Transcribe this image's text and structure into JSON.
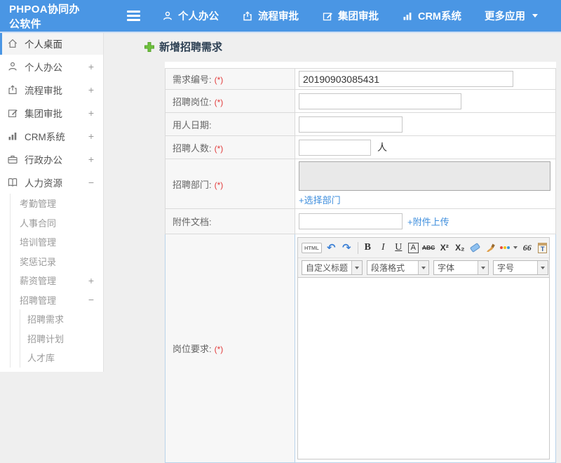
{
  "colors": {
    "topbar": "#4a96e4",
    "link": "#3e8edd",
    "required": "#e23b3b",
    "plus": "#6fc13e"
  },
  "topbar": {
    "brand": "PHPOA协同办公软件",
    "nav": [
      {
        "label": "个人办公"
      },
      {
        "label": "流程审批"
      },
      {
        "label": "集团审批"
      },
      {
        "label": "CRM系统"
      },
      {
        "label": "更多应用"
      }
    ]
  },
  "sidebar": {
    "items": [
      {
        "label": "个人桌面"
      },
      {
        "label": "个人办公",
        "expand": "+"
      },
      {
        "label": "流程审批",
        "expand": "+"
      },
      {
        "label": "集团审批",
        "expand": "+"
      },
      {
        "label": "CRM系统",
        "expand": "+"
      },
      {
        "label": "行政办公",
        "expand": "+"
      },
      {
        "label": "人力资源",
        "expand": "−"
      },
      {
        "label": "考勤管理"
      },
      {
        "label": "人事合同"
      },
      {
        "label": "培训管理"
      },
      {
        "label": "奖惩记录"
      },
      {
        "label": "薪资管理",
        "expand": "+"
      },
      {
        "label": "招聘管理",
        "expand": "−"
      },
      {
        "label": "招聘需求"
      },
      {
        "label": "招聘计划"
      },
      {
        "label": "人才库"
      }
    ]
  },
  "main": {
    "page_title": "新增招聘需求",
    "form": {
      "rows": [
        {
          "label": "需求编号:",
          "required": "(*)",
          "value": "20190903085431"
        },
        {
          "label": "招聘岗位:",
          "required": "(*)",
          "value": ""
        },
        {
          "label": "用人日期:",
          "value": ""
        },
        {
          "label": "招聘人数:",
          "required": "(*)",
          "value": "",
          "suffix": "人"
        },
        {
          "label": "招聘部门:",
          "required": "(*)",
          "link": "+选择部门"
        },
        {
          "label": "附件文档:",
          "value": "",
          "link": "+附件上传"
        },
        {
          "label": "岗位要求:",
          "required": "(*)"
        }
      ]
    },
    "editor": {
      "buttons": {
        "html": "HTML",
        "undo": "↶",
        "redo": "↷",
        "bold": "B",
        "italic": "I",
        "underline": "U",
        "font_box": "A",
        "strike": "ABC",
        "sup": "X²",
        "sub": "X₂",
        "quote": "66",
        "paste": "T",
        "font_color": "A",
        "bg_color": "a"
      },
      "selects": {
        "heading": "自定义标题",
        "paragraph": "段落格式",
        "font": "字体",
        "size": "字号"
      }
    }
  }
}
